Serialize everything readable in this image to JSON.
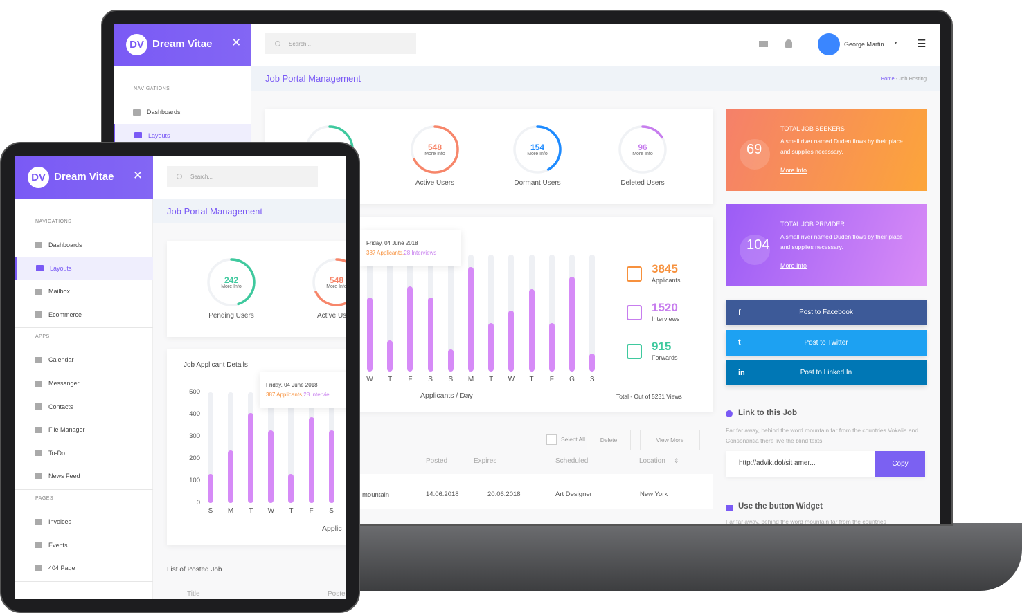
{
  "brand": {
    "initials": "DV",
    "name": "Dream Vitae"
  },
  "search": {
    "placeholder": "Search..."
  },
  "user": {
    "name": "George Martin"
  },
  "page": {
    "title": "Job Portal Management",
    "breadcrumb": [
      "Home",
      "Job Hosting"
    ]
  },
  "sidebar": {
    "sections": [
      {
        "title": "NAVIGATIONS",
        "items": [
          {
            "label": "Dashboards",
            "icon": "grid-icon"
          },
          {
            "label": "Layouts",
            "icon": "layout-icon",
            "active": true
          },
          {
            "label": "Mailbox",
            "icon": "mail-icon"
          },
          {
            "label": "Ecommerce",
            "icon": "cart-icon"
          }
        ]
      },
      {
        "title": "APPS",
        "items": [
          {
            "label": "Calendar",
            "icon": "calendar-icon"
          },
          {
            "label": "Messanger",
            "icon": "chat-icon"
          },
          {
            "label": "Contacts",
            "icon": "contact-icon"
          },
          {
            "label": "File Manager",
            "icon": "folder-icon"
          },
          {
            "label": "To-Do",
            "icon": "clipboard-icon"
          },
          {
            "label": "News Feed",
            "icon": "news-icon"
          }
        ]
      },
      {
        "title": "PAGES",
        "items": [
          {
            "label": "Invoices",
            "icon": "invoice-icon"
          },
          {
            "label": "Events",
            "icon": "events-icon"
          },
          {
            "label": "404 Page",
            "icon": "error-page-icon"
          }
        ]
      }
    ]
  },
  "gauges": [
    {
      "value": "242",
      "sub": "More Info",
      "label": "Pending Users",
      "progress": 0.45,
      "color": "#3fc99e"
    },
    {
      "value": "548",
      "sub": "More Info",
      "label": "Active Users",
      "progress": 0.68,
      "color": "#f7866a"
    },
    {
      "value": "154",
      "sub": "More Info",
      "label": "Dormant Users",
      "progress": 0.42,
      "color": "#1e8bff"
    },
    {
      "value": "96",
      "sub": "More Info",
      "label": "Deleted Users",
      "progress": 0.16,
      "color": "#c77dee"
    }
  ],
  "chart_data": [
    {
      "type": "bar",
      "title": "",
      "xlabel": "Applicants / Day",
      "categories": [
        "W",
        "T",
        "F",
        "S",
        "S",
        "M",
        "T",
        "W",
        "T",
        "F",
        "G",
        "S"
      ],
      "values": [
        334,
        141,
        387,
        334,
        100,
        472,
        219,
        275,
        372,
        219,
        431,
        81
      ],
      "ylim": [
        0,
        530
      ],
      "color": "#d68bf7",
      "track_color": "#eef0f4",
      "tooltip": {
        "date": "Friday, 04 June 2018",
        "applicants": "387 Applicants,",
        "interviews": "28 Interviews"
      }
    },
    {
      "type": "bar",
      "title": "Job Applicant Details",
      "xlabel": "Applic",
      "categories": [
        "S",
        "M",
        "T",
        "W",
        "T",
        "F",
        "S"
      ],
      "values": [
        131,
        237,
        406,
        328,
        131,
        387,
        328
      ],
      "ylim": [
        0,
        500
      ],
      "yticks": [
        "500",
        "400",
        "300",
        "200",
        "100",
        "0"
      ],
      "color": "#d68bf7",
      "tooltip": {
        "date": "Friday, 04 June 2018",
        "applicants": "387 Applicants,",
        "interviews": "28 Intervie"
      }
    }
  ],
  "stats": [
    {
      "value": "3845",
      "label": "Applicants",
      "color": "#f7913d",
      "icon": "notepad-icon"
    },
    {
      "value": "1520",
      "label": "Interviews",
      "color": "#c77dee",
      "icon": "interview-icon"
    },
    {
      "value": "915",
      "label": "Forwards",
      "color": "#3fc99e",
      "icon": "forward-arrow-icon"
    }
  ],
  "stats_total": "Total - Out of 5231 Views",
  "info_cards": [
    {
      "number": "69",
      "title": "TOTAL JOB SEEKERS",
      "text": "A small river named Duden flows by their place and supplies necessary.",
      "link": "More Info"
    },
    {
      "number": "104",
      "title": "TOTAL JOB PRIVIDER",
      "text": "A small river named Duden flows by their place and supplies necessary.",
      "link": "More Info"
    }
  ],
  "social": [
    {
      "label": "Post to Facebook",
      "icon": "f",
      "color": "#3d5a98"
    },
    {
      "label": "Post to Twitter",
      "icon": "t",
      "color": "#1da1f2"
    },
    {
      "label": "Post to Linked In",
      "icon": "in",
      "color": "#0077b5"
    }
  ],
  "link_job": {
    "title": "Link to this Job",
    "text": "Far far away, behind the word mountain far from the countries Vokalia and Consonantia there live the blind texts.",
    "url": "http://advik.dol/sit amer...",
    "copy": "Copy"
  },
  "widget": {
    "title": "Use the button Widget",
    "text": "Far far away, behind the word mountain far from the countries"
  },
  "table": {
    "select_all": "Select All",
    "delete": "Delete",
    "view_more": "View More",
    "title": "List of Posted Job",
    "columns": [
      "Title",
      "Posted",
      "Expires",
      "Scheduled",
      "Location"
    ],
    "rows": [
      [
        "mountain",
        "14.06.2018",
        "20.06.2018",
        "Art Designer",
        "New York"
      ]
    ]
  }
}
